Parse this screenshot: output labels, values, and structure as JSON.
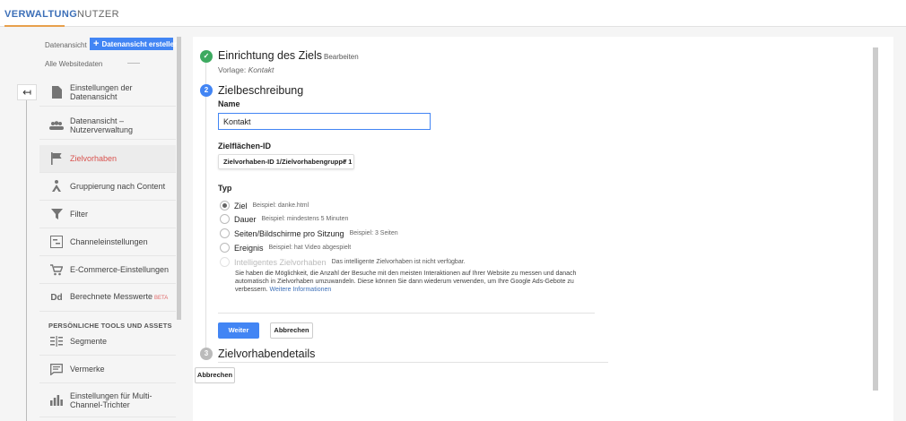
{
  "tabs": {
    "verwaltung": "VERWALTUNG",
    "nutzer": "NUTZER"
  },
  "nav": {
    "view_label": "Datenansicht",
    "create_button": "Datenansicht erstellen",
    "view_value": "Alle Websitedaten",
    "items": [
      {
        "label": "Einstellungen der Datenansicht",
        "icon": "document-icon"
      },
      {
        "label": "Datenansicht – Nutzerverwaltung",
        "icon": "people-icon"
      },
      {
        "label": "Zielvorhaben",
        "icon": "flag-icon"
      },
      {
        "label": "Gruppierung nach Content",
        "icon": "content-grouping-icon"
      },
      {
        "label": "Filter",
        "icon": "filter-icon"
      },
      {
        "label": "Channeleinstellungen",
        "icon": "channel-icon"
      },
      {
        "label": "E-Commerce-Einstellungen",
        "icon": "cart-icon"
      },
      {
        "label": "Berechnete Messwerte",
        "icon": "dd-icon",
        "badge": "BETA"
      }
    ],
    "section_head": "PERSÖNLICHE TOOLS UND ASSETS",
    "tools": [
      {
        "label": "Segmente",
        "icon": "segments-icon"
      },
      {
        "label": "Vermerke",
        "icon": "annotation-icon"
      },
      {
        "label": "Einstellungen für Multi-Channel-Trichter",
        "icon": "bar-chart-icon"
      }
    ]
  },
  "step1": {
    "number": "✓",
    "title": "Einrichtung des Ziels",
    "edit": "Bearbeiten",
    "template_prefix": "Vorlage:",
    "template_value": "Kontakt"
  },
  "step2": {
    "number": "2",
    "title": "Zielbeschreibung",
    "name_label": "Name",
    "name_value": "Kontakt",
    "zid_label": "Zielflächen-ID",
    "zid_value": "Zielvorhaben-ID 1/Zielvorhabengruppe 1",
    "typ_label": "Typ",
    "options": [
      {
        "label": "Ziel",
        "example": "Beispiel: danke.html"
      },
      {
        "label": "Dauer",
        "example": "Beispiel: mindestens 5 Minuten"
      },
      {
        "label": "Seiten/Bildschirme pro Sitzung",
        "example": "Beispiel: 3 Seiten"
      },
      {
        "label": "Ereignis",
        "example": "Beispiel: hat Video abgespielt"
      },
      {
        "label": "Intelligentes Zielvorhaben",
        "example": "Das intelligente Zielvorhaben ist nicht verfügbar."
      }
    ],
    "smart_desc": "Sie haben die Möglichkeit, die Anzahl der Besuche mit den meisten Interaktionen auf Ihrer Website zu messen und danach automatisch in Zielvorhaben umzuwandeln. Diese können Sie dann wiederum verwenden, um Ihre Google Ads-Gebote zu verbessern.",
    "smart_link": "Weitere Informationen",
    "continue": "Weiter",
    "cancel": "Abbrechen"
  },
  "step3": {
    "number": "3",
    "title": "Zielvorhabendetails"
  },
  "main_cancel": "Abbrechen",
  "colors": {
    "accent": "#4285f4",
    "active": "#d9534f",
    "success": "#3daa60",
    "tab_active": "#3c6fb8",
    "tab_underline": "#e8a04c"
  }
}
